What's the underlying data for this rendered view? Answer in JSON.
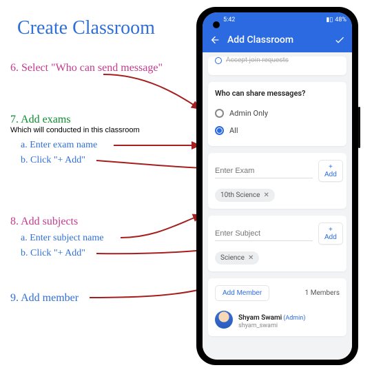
{
  "page_title": "Create Classroom",
  "steps": {
    "s6": "6. Select \"Who can send message\"",
    "s7": "7. Add exams",
    "s7_sub": "Which will conducted in this classroom",
    "s7a": "a. Enter exam name",
    "s7b": "b. Click \"+ Add\"",
    "s8": "8. Add subjects",
    "s8a": "a. Enter subject name",
    "s8b": "b. Click \"+ Add\"",
    "s9": "9. Add member"
  },
  "phone": {
    "status_time": "5:42",
    "status_batt": "48%",
    "appbar_title": "Add Classroom",
    "partial_label": "Accept join requests",
    "share_q": "Who can share messages?",
    "radio_admin": "Admin Only",
    "radio_all": "All",
    "exam_placeholder": "Enter Exam",
    "subject_placeholder": "Enter Subject",
    "add_btn": "+ Add",
    "exam_chip": "10th Science",
    "subject_chip": "Science",
    "add_member": "Add Member",
    "members_count": "1 Members",
    "member_name": "Shyam Swami",
    "admin_tag": "(Admin)",
    "member_user": "shyam_swami"
  }
}
